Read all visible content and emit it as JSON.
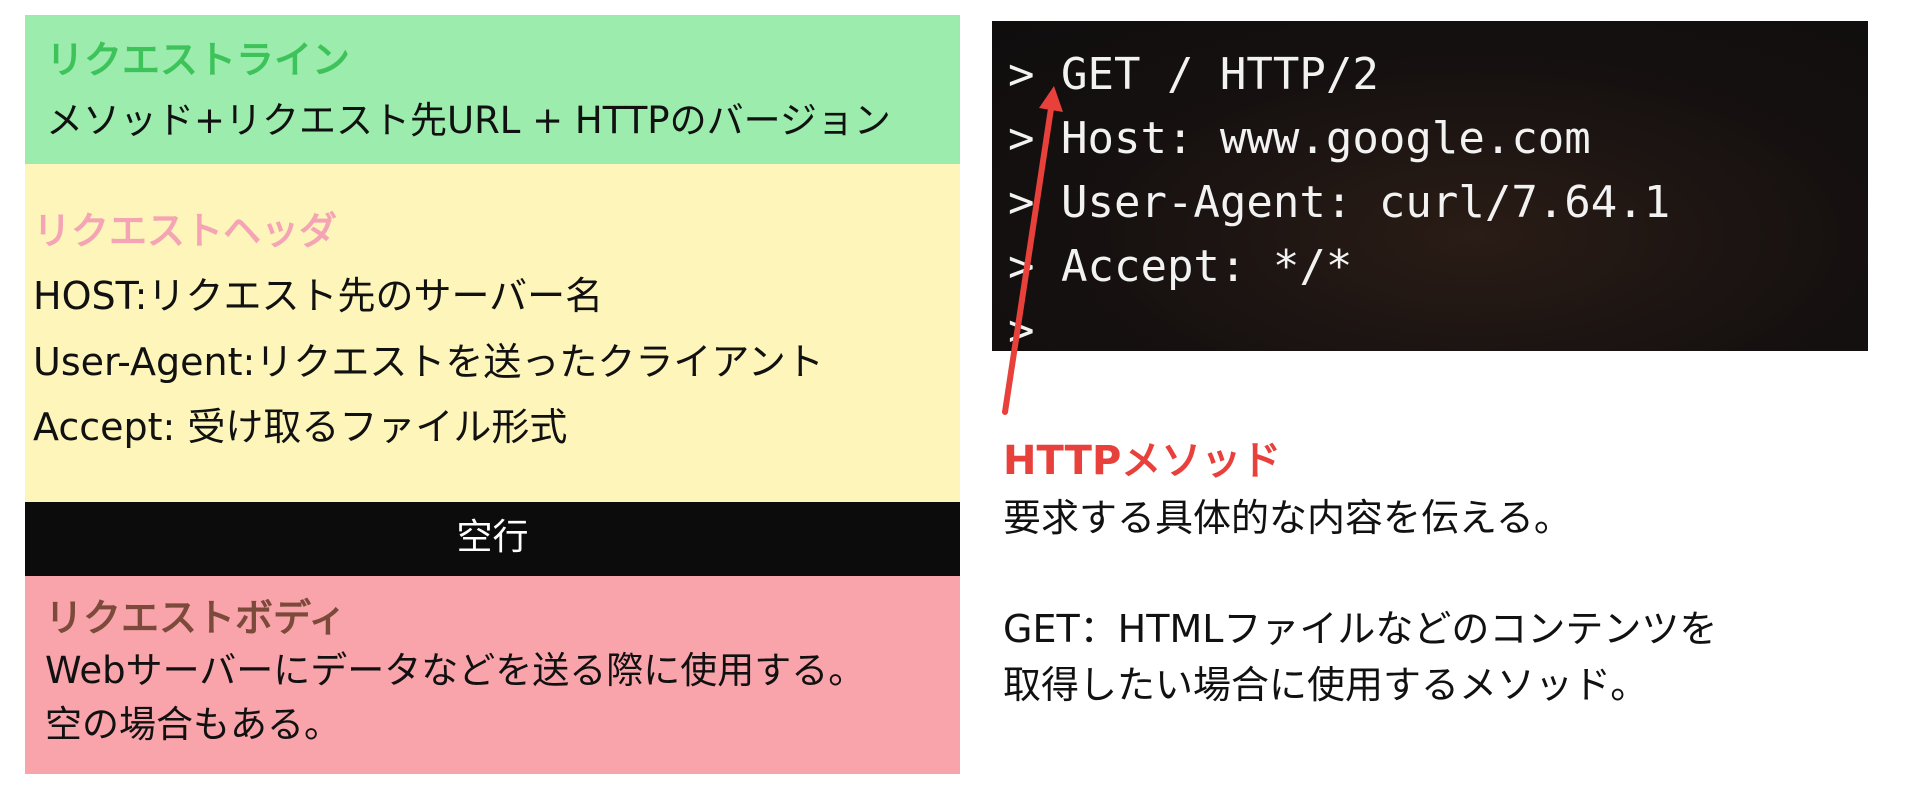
{
  "request_line": {
    "heading": "リクエストライン",
    "description": "メソッド+リクエスト先URL + HTTPのバージョン"
  },
  "request_header": {
    "heading": "リクエストヘッダ",
    "host": "HOST:リクエスト先のサーバー名",
    "user_agent": "User-Agent:リクエストを送ったクライアント",
    "accept": "Accept: 受け取るファイル形式"
  },
  "blank_line": {
    "label": "空行"
  },
  "request_body": {
    "heading": "リクエストボディ",
    "description": "Webサーバーにデータなどを送る際に使用する。空の場合もある。"
  },
  "terminal": {
    "lines": [
      "",
      "> GET / HTTP/2",
      "> Host: www.google.com",
      "> User-Agent: curl/7.64.1",
      "> Accept: */*",
      ">"
    ]
  },
  "annotation": {
    "heading": "HTTPメソッド",
    "description": "要求する具体的な内容を伝える。",
    "get_line1": "GET：HTMLファイルなどのコンテンツを",
    "get_line2": "取得したい場合に使用するメソッド。"
  },
  "colors": {
    "request_line_bg": "#9becad",
    "request_line_heading": "#3ec35a",
    "request_header_bg": "#fdf5b9",
    "request_header_heading": "#f4a4b4",
    "blank_line_bg": "#0d0c0c",
    "request_body_bg": "#f9a3ab",
    "request_body_heading": "#7c4a3a",
    "arrow": "#e8403b"
  }
}
